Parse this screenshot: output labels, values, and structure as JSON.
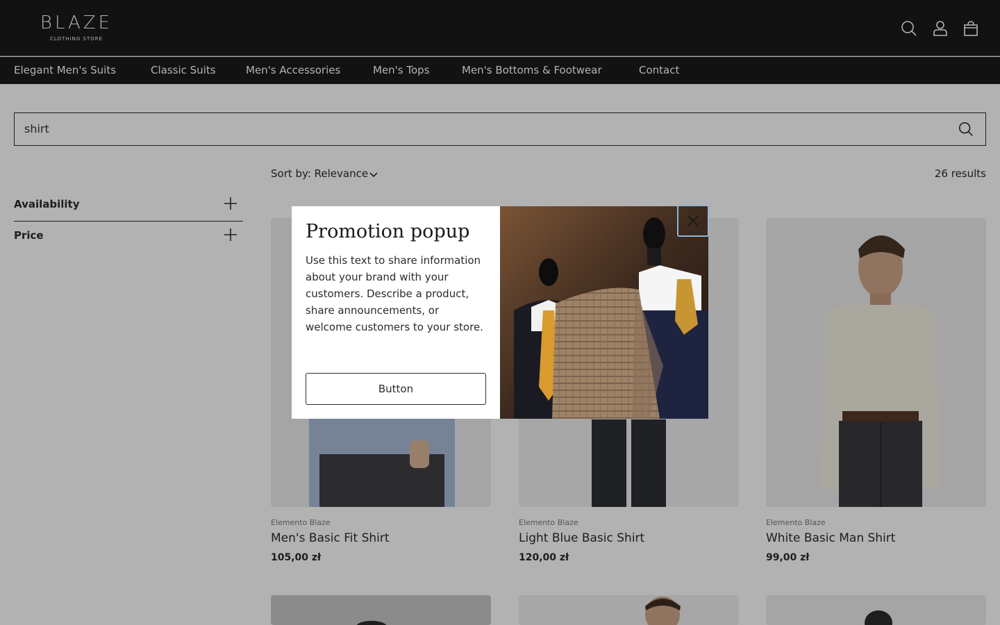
{
  "header": {
    "logo_word": "BLAZE",
    "logo_sub": "CLOTHING STORE"
  },
  "nav": {
    "items": [
      "Elegant Men's Suits",
      "Classic Suits",
      "Men's Accessories",
      "Men's Tops",
      "Men's Bottoms & Footwear",
      "Contact"
    ]
  },
  "search": {
    "value": "shirt"
  },
  "filters": [
    {
      "label": "Availability"
    },
    {
      "label": "Price"
    }
  ],
  "sort": {
    "label": "Sort by: Relevance"
  },
  "results": "26 results",
  "products": [
    {
      "vendor": "Elemento Blaze",
      "title": "Men's Basic Fit Shirt",
      "price": "105,00 zł"
    },
    {
      "vendor": "Elemento Blaze",
      "title": "Light Blue Basic Shirt",
      "price": "120,00 zł"
    },
    {
      "vendor": "Elemento Blaze",
      "title": "White Basic Man Shirt",
      "price": "99,00 zł"
    }
  ],
  "popup": {
    "title": "Promotion popup",
    "body": "Use this text to share information about your brand with your customers. Describe a product, share announcements, or welcome customers to your store.",
    "button": "Button"
  },
  "icons": {
    "search": "search-icon",
    "account": "account-icon",
    "cart": "cart-icon",
    "plus": "plus-icon",
    "chevron": "chevron-down-icon",
    "close": "close-icon"
  }
}
